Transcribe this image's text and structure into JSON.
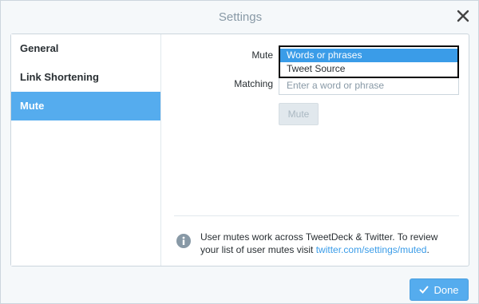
{
  "dialog": {
    "title": "Settings"
  },
  "sidebar": {
    "items": [
      {
        "label": "General"
      },
      {
        "label": "Link Shortening"
      },
      {
        "label": "Mute"
      }
    ]
  },
  "mute": {
    "mute_label": "Mute",
    "matching_label": "Matching",
    "options": [
      "Words or phrases",
      "Tweet Source"
    ],
    "matching_placeholder": "Enter a word or phrase",
    "mute_button": "Mute"
  },
  "info": {
    "text": "User mutes work across TweetDeck & Twitter. To review your list of user mutes visit ",
    "link": "twitter.com/settings/muted",
    "period": "."
  },
  "footer": {
    "done_label": "Done"
  },
  "colors": {
    "accent": "#55acee",
    "selected_option": "#3a9ce8"
  }
}
